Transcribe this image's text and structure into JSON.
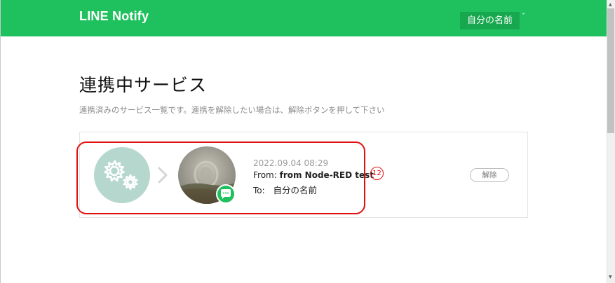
{
  "header": {
    "logo": "LINE Notify",
    "user_name": "自分の名前",
    "user_menu_chevron": "˅",
    "color": "#1fc15e"
  },
  "main": {
    "title": "連携中サービス",
    "description": "連携済みのサービス一覧です。連携を解除したい場合は、解除ボタンを押して下さい"
  },
  "connection": {
    "service_icon": "gears-icon",
    "arrow_icon": "chevron-right-icon",
    "target_icon": "chat-bubble-icon",
    "timestamp": "2022.09.04 08:29",
    "from_label": "From:",
    "from_value": "from Node-RED test",
    "to_label": "To:",
    "to_value": "自分の名前",
    "unlink_label": "解除"
  },
  "annotation": {
    "marker": "12",
    "color": "#e01010"
  },
  "scrollbar": {
    "up_glyph": "▲",
    "down_glyph": "▼"
  }
}
